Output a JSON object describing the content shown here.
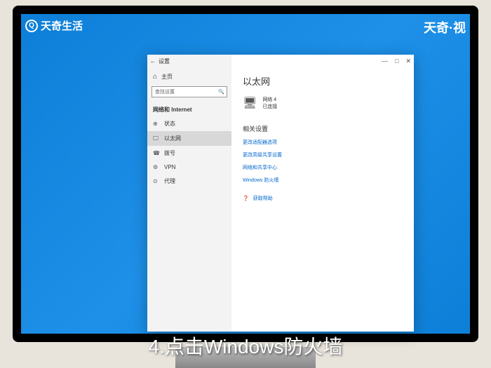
{
  "watermark": {
    "topleft": "天奇生活",
    "topright": "天奇·视"
  },
  "caption": "4.点击Windows防火墙",
  "window": {
    "title": "设置",
    "controls": {
      "min": "—",
      "max": "□",
      "close": "✕"
    }
  },
  "sidebar": {
    "home": "主页",
    "search_placeholder": "查找设置",
    "category": "网络和 Internet",
    "items": [
      {
        "icon": "⊕",
        "label": "状态"
      },
      {
        "icon": "🖵",
        "label": "以太网"
      },
      {
        "icon": "☎",
        "label": "拨号"
      },
      {
        "icon": "⚙",
        "label": "VPN"
      },
      {
        "icon": "⊙",
        "label": "代理"
      }
    ]
  },
  "content": {
    "title": "以太网",
    "network": {
      "name": "网络 4",
      "status": "已连接"
    },
    "related_title": "相关设置",
    "links": [
      "更改适配器选项",
      "更改高级共享设置",
      "网络和共享中心",
      "Windows 防火墙"
    ],
    "help": "获取帮助"
  }
}
